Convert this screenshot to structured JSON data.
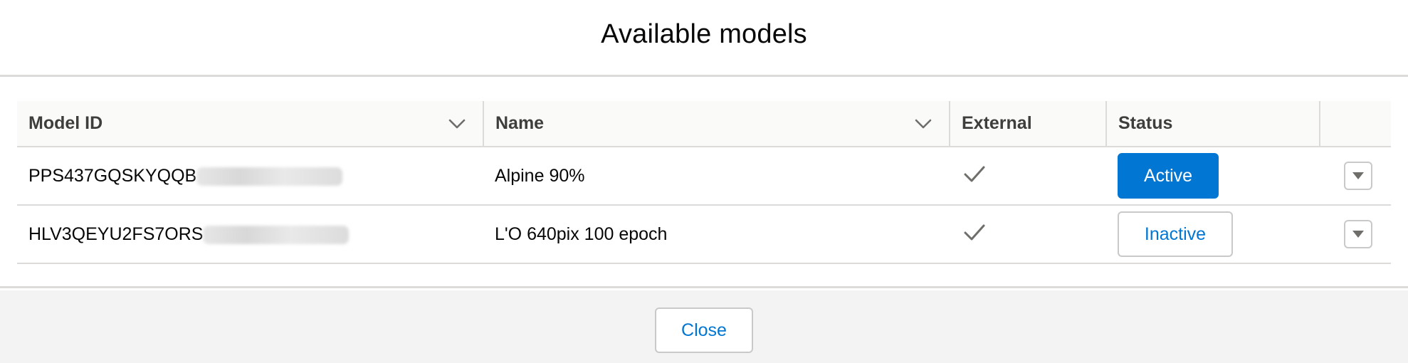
{
  "modal": {
    "title": "Available models"
  },
  "table": {
    "columns": [
      {
        "label": "Model ID",
        "sortable": true
      },
      {
        "label": "Name",
        "sortable": true
      },
      {
        "label": "External",
        "sortable": false
      },
      {
        "label": "Status",
        "sortable": false
      },
      {
        "label": "",
        "sortable": false
      }
    ],
    "rows": [
      {
        "model_id": "PPS437GQSKYQQB",
        "name": "Alpine 90%",
        "external": true,
        "status": "Active",
        "status_active": true
      },
      {
        "model_id": "HLV3QEYU2FS7ORS",
        "name": "L'O 640pix 100 epoch",
        "external": true,
        "status": "Inactive",
        "status_active": false
      }
    ]
  },
  "footer": {
    "close_label": "Close"
  },
  "icons": {
    "sort": "chevron-down-icon",
    "external": "check-icon",
    "row_action": "caret-down-icon"
  },
  "colors": {
    "brand": "#0176d3",
    "border": "#dddbda",
    "footer_bg": "#f3f3f3",
    "header_bg": "#fafaf9"
  }
}
